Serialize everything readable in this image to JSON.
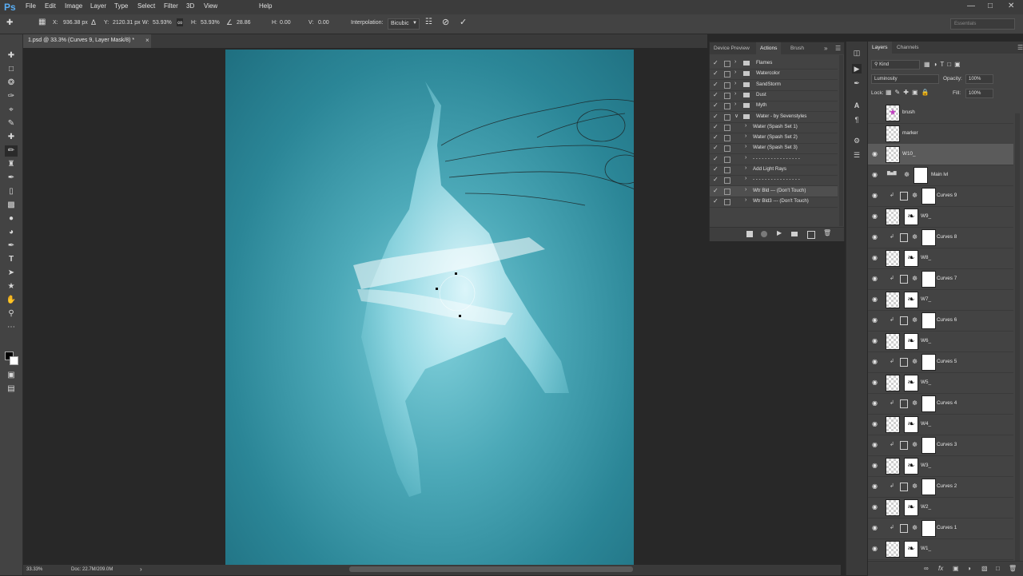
{
  "app": {
    "logo": "Ps",
    "workspace": "Essentials"
  },
  "menu": [
    "File",
    "Edit",
    "Image",
    "Layer",
    "Type",
    "Select",
    "Filter",
    "3D",
    "View",
    "Help"
  ],
  "options_bar": {
    "x_label": "X:",
    "x_value": "936.38 px",
    "y_label": "Y:",
    "y_value": "2120.31 px",
    "w_label": "W:",
    "w_value": "53.93%",
    "h_label": "H:",
    "h_value": "53.93%",
    "angle_value": "28.86",
    "hskew_label": "H:",
    "hskew_value": "0.00",
    "vskew_label": "V:",
    "vskew_value": "0.00",
    "interp_label": "Interpolation:",
    "interp_value": "Bicubic"
  },
  "document": {
    "tab_title": "1.psd @ 33.3% (Curves 9, Layer Mask/8) *",
    "close": "×"
  },
  "status": {
    "zoom": "33.33%",
    "doc": "Doc: 22.7M/209.0M"
  },
  "actions_panel": {
    "tabs": [
      "Device Preview",
      "Actions",
      "Brush"
    ],
    "active_tab": "Actions",
    "rows": [
      {
        "label": "Flames",
        "checked": true,
        "folder": true
      },
      {
        "label": "Watercolor",
        "checked": true,
        "folder": true
      },
      {
        "label": "SandStorm",
        "checked": true,
        "folder": true
      },
      {
        "label": "Dust",
        "checked": true,
        "folder": true
      },
      {
        "label": "Myth",
        "checked": true,
        "folder": true
      },
      {
        "label": "Water - by Sevenstyles",
        "checked": true,
        "folder": true,
        "expanded": true
      },
      {
        "label": "Water (Spash Set 1)",
        "checked": true,
        "folder": false
      },
      {
        "label": "Water (Spash Set 2)",
        "checked": true,
        "folder": false
      },
      {
        "label": "Water (Spash Set 3)",
        "checked": true,
        "folder": false
      },
      {
        "label": "- - - - - - - - - - - - - - - -",
        "checked": true,
        "folder": false
      },
      {
        "label": "Add Light Rays",
        "checked": true,
        "folder": false
      },
      {
        "label": "- - - - - - - - - - - - - - - -",
        "checked": true,
        "folder": false
      },
      {
        "label": "Wtr Bld --- (Don't Touch)",
        "checked": true,
        "folder": false
      },
      {
        "label": "Wtr Bld3 --- (Don't Touch)",
        "checked": true,
        "folder": false
      }
    ]
  },
  "layers_panel": {
    "tabs": [
      "Layers",
      "Channels"
    ],
    "filter_kind": "Kind",
    "blend_mode": "Luminosity",
    "opacity_label": "Opacity:",
    "opacity_value": "100%",
    "lock_label": "Lock:",
    "fill_label": "Fill:",
    "fill_value": "100%",
    "layers": [
      {
        "name": "brush",
        "type": "pixel"
      },
      {
        "name": "marker",
        "type": "pixel"
      },
      {
        "name": "W10_",
        "type": "pixel",
        "selected": true
      },
      {
        "name": "Main lvl",
        "type": "adjust"
      },
      {
        "name": "Curves 9",
        "type": "adjust"
      },
      {
        "name": "W9_",
        "type": "pixel"
      },
      {
        "name": "Curves 8",
        "type": "adjust"
      },
      {
        "name": "W8_",
        "type": "pixel"
      },
      {
        "name": "Curves 7",
        "type": "adjust"
      },
      {
        "name": "W7_",
        "type": "pixel"
      },
      {
        "name": "Curves 6",
        "type": "adjust"
      },
      {
        "name": "W6_",
        "type": "pixel"
      },
      {
        "name": "Curves 5",
        "type": "adjust"
      },
      {
        "name": "W5_",
        "type": "pixel"
      },
      {
        "name": "Curves 4",
        "type": "adjust"
      },
      {
        "name": "W4_",
        "type": "pixel"
      },
      {
        "name": "Curves 3",
        "type": "adjust"
      },
      {
        "name": "W3_",
        "type": "pixel"
      },
      {
        "name": "Curves 2",
        "type": "adjust"
      },
      {
        "name": "W2_",
        "type": "pixel"
      },
      {
        "name": "Curves 1",
        "type": "adjust"
      },
      {
        "name": "W1_",
        "type": "pixel"
      }
    ]
  },
  "colors": {
    "canvas_center": "#7fcfda",
    "canvas_edge": "#1f6f80",
    "accent": "#59aef5"
  }
}
